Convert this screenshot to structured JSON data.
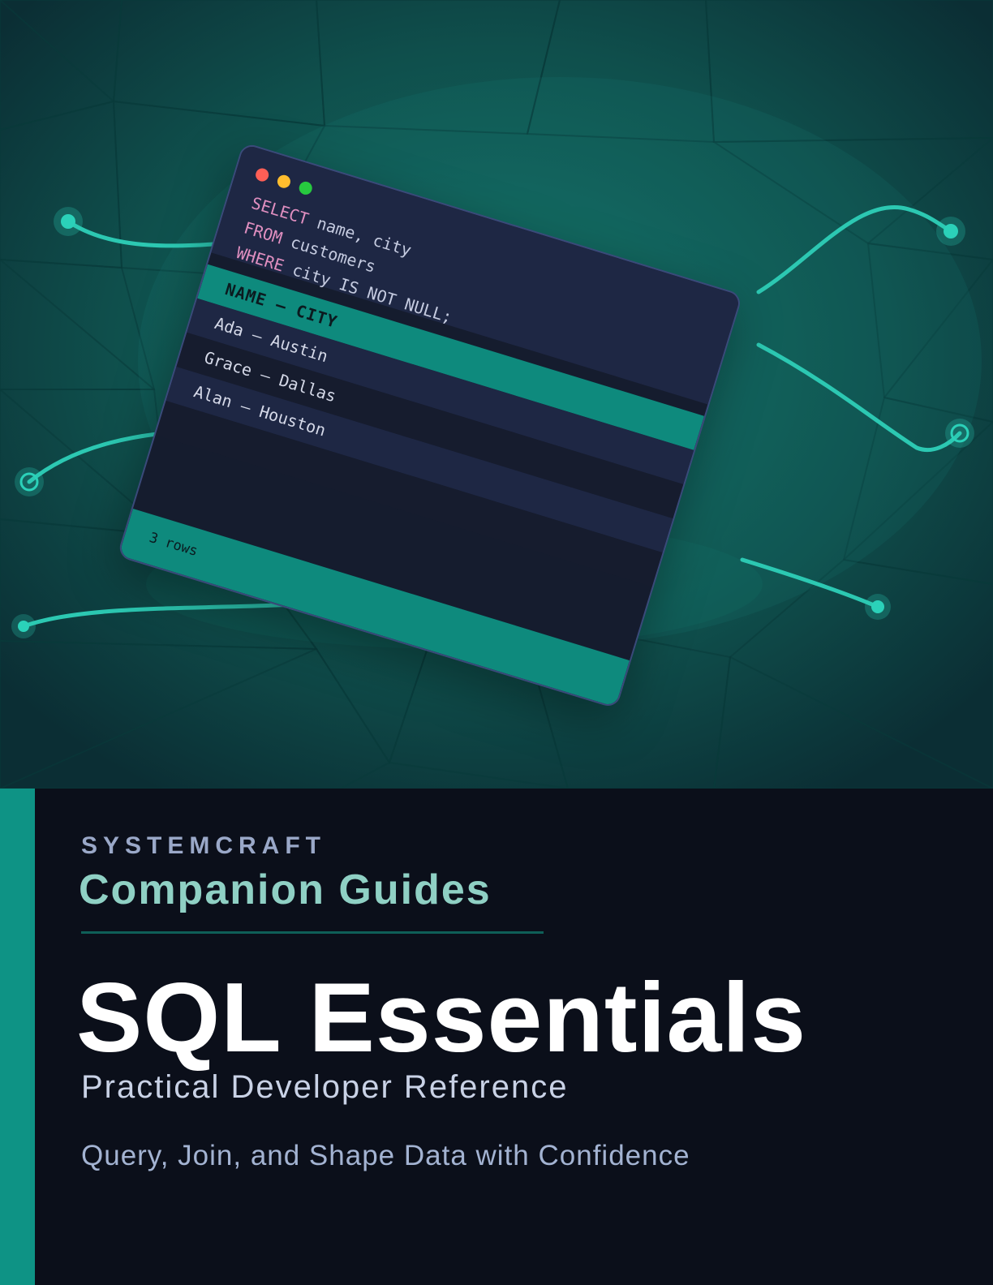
{
  "hero": {
    "window": {
      "dot_colors": [
        "#ff5f56",
        "#ffbd2e",
        "#27c93f"
      ],
      "code_lines": [
        {
          "keyword": "SELECT",
          "rest": " name, city"
        },
        {
          "keyword": "FROM",
          "rest": " customers"
        },
        {
          "keyword": "WHERE",
          "rest": " city IS NOT NULL;"
        }
      ],
      "table_header": "NAME — CITY",
      "rows": [
        "Ada — Austin",
        "Grace — Dallas",
        "Alan — Houston"
      ],
      "footer": "3 rows"
    }
  },
  "cover": {
    "brand": "SYSTEMCRAFT",
    "series": "Companion Guides",
    "title": "SQL Essentials",
    "subtitle": "Practical Developer Reference",
    "tagline": "Query, Join, and Shape Data with Confidence"
  },
  "colors": {
    "accent": "#0e9385",
    "background": "#0b0f1a",
    "hero": "#0e3b3b"
  }
}
